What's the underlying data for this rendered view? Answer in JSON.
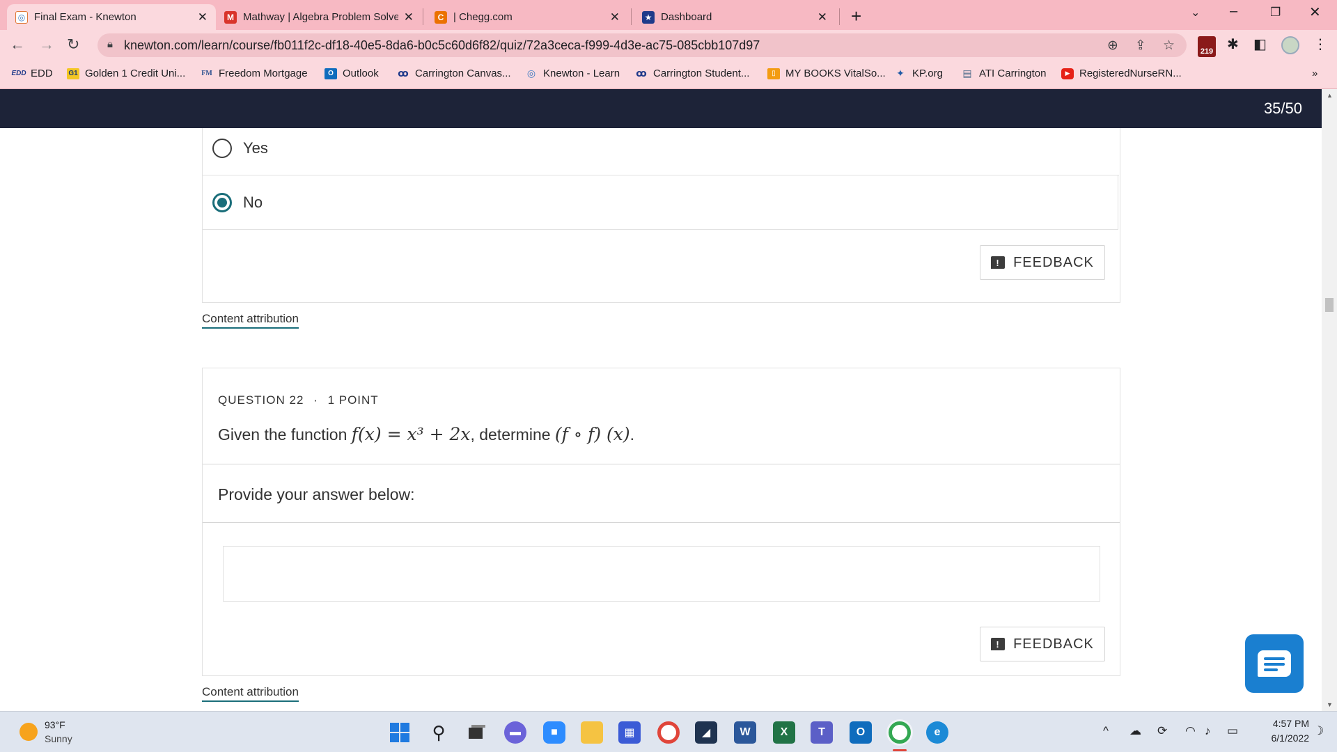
{
  "browser": {
    "tabs": [
      {
        "title": "Final Exam - Knewton",
        "icon": "knewton-icon",
        "active": true
      },
      {
        "title": "Mathway | Algebra Problem Solve",
        "icon": "mathway-icon",
        "active": false
      },
      {
        "title": "| Chegg.com",
        "icon": "chegg-icon",
        "active": false
      },
      {
        "title": "Dashboard",
        "icon": "star-shield-icon",
        "active": false
      }
    ],
    "close_glyph": "✕",
    "new_tab_glyph": "+",
    "url": "knewton.com/learn/course/fb011f2c-df18-40e5-8da6-b0c5c60d6f82/quiz/72a3ceca-f999-4d3e-ac75-085cbb107d97",
    "extension_badge": "219",
    "bookmarks": [
      {
        "label": "EDD",
        "icon": "edd-icon",
        "icon_text": "EDD"
      },
      {
        "label": "Golden 1 Credit Uni...",
        "icon": "golden1-icon",
        "icon_text": "G1"
      },
      {
        "label": "Freedom Mortgage",
        "icon": "fm-icon",
        "icon_text": "FM"
      },
      {
        "label": "Outlook",
        "icon": "outlook-icon",
        "icon_text": "O"
      },
      {
        "label": "Carrington Canvas...",
        "icon": "carrington-icon",
        "icon_text": "ꝏ"
      },
      {
        "label": "Knewton - Learn",
        "icon": "knewton-icon",
        "icon_text": "◎"
      },
      {
        "label": "Carrington Student...",
        "icon": "carrington-icon",
        "icon_text": "ꝏ"
      },
      {
        "label": "MY BOOKS VitalSo...",
        "icon": "vitalsource-icon",
        "icon_text": "▯"
      },
      {
        "label": "KP.org",
        "icon": "kp-icon",
        "icon_text": "✦"
      },
      {
        "label": "ATI Carrington",
        "icon": "ati-icon",
        "icon_text": "▤"
      },
      {
        "label": "RegisteredNurseRN...",
        "icon": "youtube-icon",
        "icon_text": "▶"
      }
    ],
    "bookmarks_more": "»"
  },
  "quiz": {
    "progress": "35/50",
    "prev_question": {
      "options": [
        {
          "label": "Yes",
          "selected": false
        },
        {
          "label": "No",
          "selected": true
        }
      ],
      "feedback_label": "FEEDBACK",
      "attribution": "Content attribution"
    },
    "question": {
      "number_label": "QUESTION 22",
      "separator": "·",
      "points_label": "1 POINT",
      "text_prefix": "Given the function ",
      "function_math": "f(x) = x³ + 2x",
      "text_middle": ", determine ",
      "composition_math": "(f ∘ f) (x)",
      "text_suffix": ".",
      "provide_label": "Provide your answer below:",
      "answer_value": "",
      "feedback_label": "FEEDBACK",
      "attribution": "Content attribution"
    }
  },
  "taskbar": {
    "weather_temp": "93°F",
    "weather_desc": "Sunny",
    "time": "4:57 PM",
    "date": "6/1/2022"
  },
  "colors": {
    "chrome_pink": "#f7b9c3",
    "nav_dark": "#1d2338",
    "radio_teal": "#1a6e7a",
    "chat_blue": "#1a7fd0"
  }
}
